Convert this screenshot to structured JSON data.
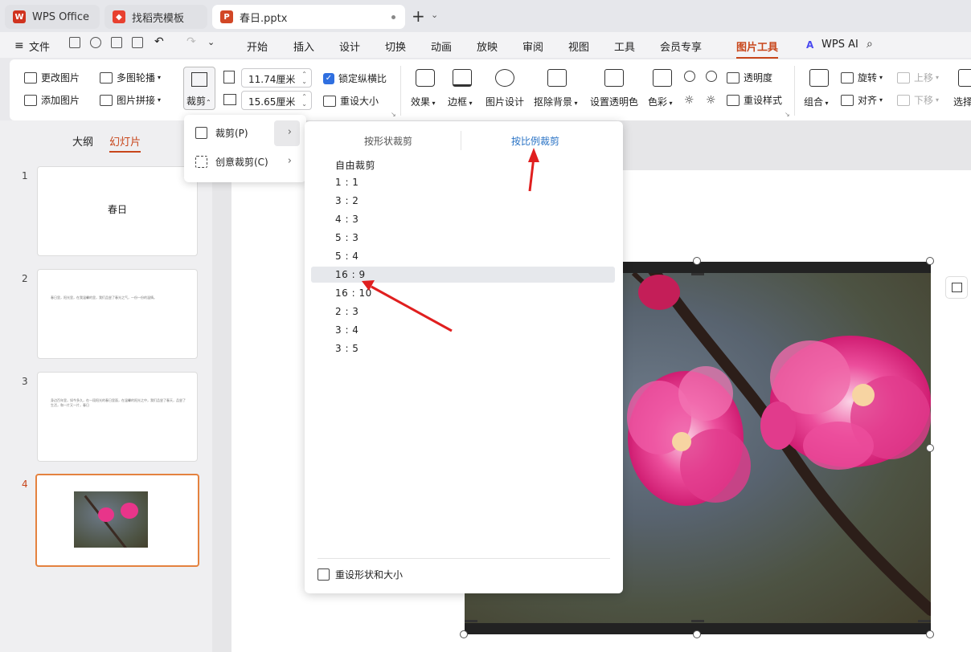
{
  "tabs": [
    {
      "label": "WPS Office",
      "icon": "wps-logo-icon",
      "color": "#d0331f"
    },
    {
      "label": "找稻壳模板",
      "icon": "docer-icon",
      "color": "#e8402f"
    },
    {
      "label": "春日.pptx",
      "icon": "ppt-file-icon",
      "color": "#d24726"
    }
  ],
  "menu": {
    "file": "文件",
    "items": [
      "开始",
      "插入",
      "设计",
      "切换",
      "动画",
      "放映",
      "审阅",
      "视图",
      "工具",
      "会员专享",
      "图片工具"
    ],
    "active": "图片工具",
    "ai": "WPS AI"
  },
  "ribbon": {
    "change_image": "更改图片",
    "add_image": "添加图片",
    "multi_carousel": "多图轮播",
    "image_stitch": "图片拼接",
    "crop": "裁剪",
    "width": "11.74厘米",
    "height": "15.65厘米",
    "lock_ratio": "锁定纵横比",
    "reset_size": "重设大小",
    "effects": "效果",
    "border": "边框",
    "image_design": "图片设计",
    "remove_bg": "抠除背景",
    "set_transparent": "设置透明色",
    "color": "色彩",
    "transparency": "透明度",
    "reset_style": "重设样式",
    "combine": "组合",
    "rotate": "旋转",
    "align": "对齐",
    "move_up": "上移",
    "move_down": "下移",
    "select": "选择"
  },
  "left_panel": {
    "tab_outline": "大纲",
    "tab_slides": "幻灯片",
    "slides": [
      {
        "num": "1",
        "title": "春日"
      },
      {
        "num": "2",
        "text": "春日里，阳光里，在我温馨的里，我们品尝了春光之气，一份一份的温情。"
      },
      {
        "num": "3",
        "text": "身边百年里，如今多久，在一段阳光的春日里面，在温馨的阳光之中，我们品尝了春天，品尝了生活，和一片又一片，春日"
      },
      {
        "num": "4"
      }
    ]
  },
  "crop_menu": {
    "crop": "裁剪(P)",
    "creative_crop": "创意裁剪(C)"
  },
  "crop_submenu": {
    "tab_shape": "按形状裁剪",
    "tab_ratio": "按比例裁剪",
    "ratios": [
      "自由裁剪",
      "1 : 1",
      "3 : 2",
      "4 : 3",
      "5 : 3",
      "5 : 4",
      "16 : 9",
      "16 : 10",
      "2 : 3",
      "3 : 4",
      "3 : 5"
    ],
    "highlighted": "16 : 9",
    "reset": "重设形状和大小"
  },
  "colors": {
    "accent": "#c8461b",
    "link_blue": "#2a73c5",
    "arrow_red": "#e01f1f",
    "flower_pink": "#e8358a"
  }
}
